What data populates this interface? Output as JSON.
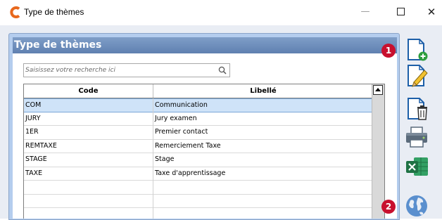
{
  "window": {
    "title": "Type de thèmes",
    "minimize_glyph": "—",
    "close_glyph": "✕"
  },
  "panel": {
    "title": "Type de thèmes"
  },
  "search": {
    "placeholder": "Saisissez votre recherche ici",
    "value": ""
  },
  "table": {
    "columns": [
      "Code",
      "Libellé"
    ],
    "rows": [
      {
        "code": "COM",
        "libelle": "Communication",
        "selected": true
      },
      {
        "code": "JURY",
        "libelle": "Jury examen",
        "selected": false
      },
      {
        "code": "1ER",
        "libelle": "Premier contact",
        "selected": false
      },
      {
        "code": "REMTAXE",
        "libelle": "Remerciement Taxe",
        "selected": false
      },
      {
        "code": "STAGE",
        "libelle": "Stage",
        "selected": false
      },
      {
        "code": "TAXE",
        "libelle": "Taxe d'apprentissage",
        "selected": false
      },
      {
        "code": "",
        "libelle": "",
        "selected": false
      },
      {
        "code": "",
        "libelle": "",
        "selected": false
      },
      {
        "code": "",
        "libelle": "",
        "selected": false
      }
    ]
  },
  "toolbar": {
    "items": [
      {
        "name": "new-document-icon"
      },
      {
        "name": "edit-document-icon"
      },
      {
        "name": "delete-document-icon"
      },
      {
        "name": "printer-icon"
      },
      {
        "name": "excel-icon"
      },
      {
        "name": "globe-icon"
      }
    ]
  },
  "badges": {
    "first": "1",
    "second": "2"
  },
  "colors": {
    "accent": "#5f80b0",
    "selection": "#cfe3f8",
    "badge": "#c8102e",
    "excel_green": "#1f7244"
  }
}
